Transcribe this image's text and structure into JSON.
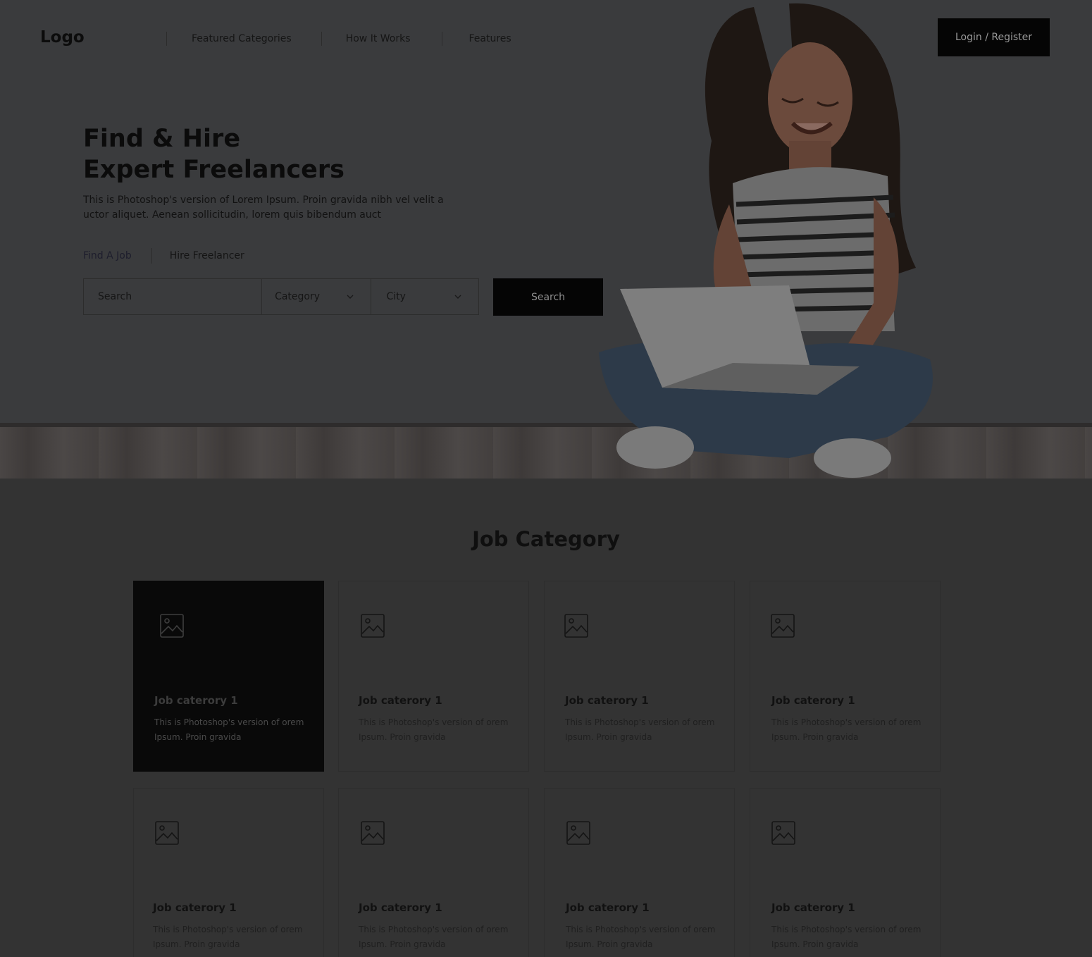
{
  "header": {
    "logo": "Logo",
    "nav": [
      "Featured Categories",
      "How It Works",
      "Features"
    ],
    "login": "Login / Register"
  },
  "hero": {
    "title_line1": "Find & Hire",
    "title_line2": "Expert Freelancers",
    "description": "This is Photoshop's version  of Lorem Ipsum. Proin gravida nibh vel velit a uctor aliquet. Aenean sollicitudin, lorem quis bibendum auct",
    "tabs": [
      "Find A Job",
      "Hire Freelancer"
    ],
    "search_placeholder": "Search",
    "category_select": "Category",
    "city_select": "City",
    "search_button": "Search"
  },
  "categories": {
    "title": "Job Category",
    "items": [
      {
        "title": "Job caterory 1",
        "desc": "This is Photoshop's version  of orem Ipsum. Proin gravida",
        "active": true
      },
      {
        "title": "Job caterory 1",
        "desc": "This is Photoshop's version  of orem Ipsum. Proin gravida"
      },
      {
        "title": "Job caterory 1",
        "desc": "This is Photoshop's version  of orem Ipsum. Proin gravida"
      },
      {
        "title": "Job caterory 1",
        "desc": "This is Photoshop's version  of orem Ipsum. Proin gravida"
      },
      {
        "title": "Job caterory 1",
        "desc": "This is Photoshop's version  of orem Ipsum. Proin gravida"
      },
      {
        "title": "Job caterory 1",
        "desc": "This is Photoshop's version  of orem Ipsum. Proin gravida"
      },
      {
        "title": "Job caterory 1",
        "desc": "This is Photoshop's version  of orem Ipsum. Proin gravida"
      },
      {
        "title": "Job caterory 1",
        "desc": "This is Photoshop's version  of orem Ipsum. Proin gravida"
      }
    ],
    "icon": "image-icon"
  }
}
